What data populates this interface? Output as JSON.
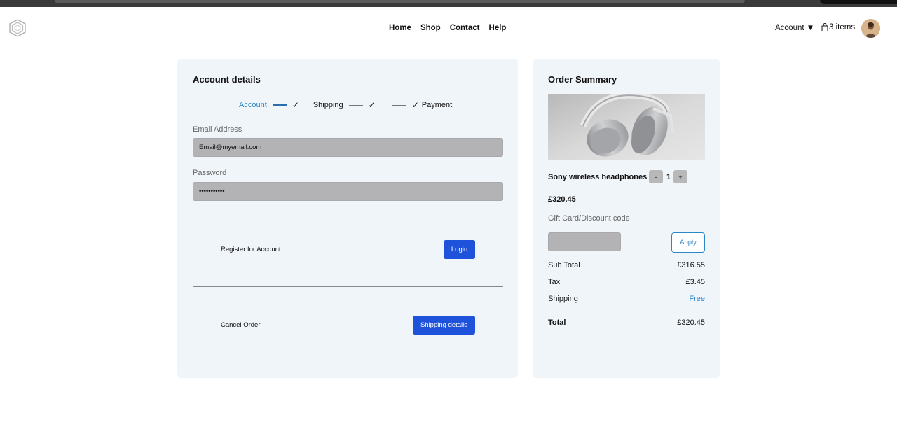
{
  "nav": {
    "items": [
      "Home",
      "Shop",
      "Contact",
      "Help"
    ],
    "account_label": "Account ▼",
    "cart_label": "3 items"
  },
  "account_panel": {
    "title": "Account details",
    "steps": [
      {
        "label": "Account",
        "state": "active"
      },
      {
        "label": "Shipping",
        "state": "pending"
      },
      {
        "label": "Payment",
        "state": "pending"
      }
    ],
    "check": "✓",
    "email_label": "Email Address",
    "email_value": "Email@myemail.com",
    "password_label": "Password",
    "password_value": "•••••••••••",
    "register_link": "Register for Account",
    "login_button": "Login",
    "cancel_link": "Cancel Order",
    "shipping_button": "Shipping details"
  },
  "order_summary": {
    "title": "Order Summary",
    "product_name": "Sony wireless headphones",
    "qty_minus": "-",
    "quantity": "1",
    "qty_plus": "+",
    "price": "£320.45",
    "gift_label": "Gift Card/Discount code",
    "apply_button": "Apply",
    "rows": [
      {
        "label": "Sub Total",
        "value": "£316.55"
      },
      {
        "label": "Tax",
        "value": "£3.45"
      },
      {
        "label": "Shipping",
        "value": "Free"
      }
    ],
    "total_label": "Total",
    "total_value": "£320.45"
  },
  "colors": {
    "accent": "#2b87c6",
    "primary_button": "#1f52db",
    "panel_bg": "#f0f5fa",
    "input_bg": "#b3b2b4"
  }
}
